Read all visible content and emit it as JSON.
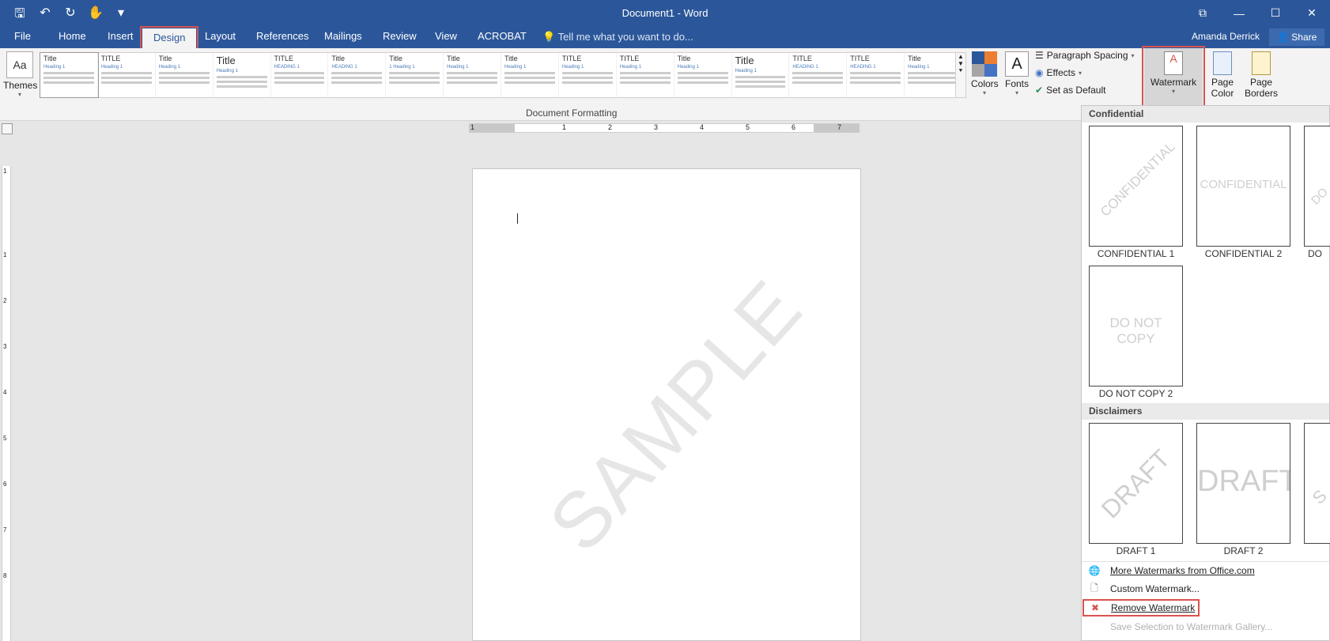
{
  "window": {
    "title": "Document1 - Word"
  },
  "qat": {
    "save": "🖫",
    "undo": "↶",
    "redo": "↻",
    "touch": "✋",
    "more": "▾"
  },
  "window_controls": {
    "restore": "⧉",
    "minimize": "—",
    "maximize": "☐",
    "close": "✕"
  },
  "tabs": {
    "file": "File",
    "home": "Home",
    "insert": "Insert",
    "design": "Design",
    "layout": "Layout",
    "references": "References",
    "mailings": "Mailings",
    "review": "Review",
    "view": "View",
    "acrobat": "ACROBAT"
  },
  "tell_me": "Tell me what you want to do...",
  "user": {
    "name": "Amanda Derrick",
    "share": "Share"
  },
  "ribbon": {
    "themes": "Themes",
    "themes_icon": "Aa",
    "group_label": "Document Formatting",
    "style_items": [
      {
        "title": "Title",
        "heading": "Heading 1"
      },
      {
        "title": "TITLE",
        "heading": "Heading 1"
      },
      {
        "title": "Title",
        "heading": "Heading 1"
      },
      {
        "title": "Title",
        "heading": "Heading 1"
      },
      {
        "title": "TITLE",
        "heading": "HEADING 1"
      },
      {
        "title": "Title",
        "heading": "HEADING 1"
      },
      {
        "title": "Title",
        "heading": "1 Heading 1"
      },
      {
        "title": "Title",
        "heading": "Heading 1"
      },
      {
        "title": "Title",
        "heading": "Heading 1"
      },
      {
        "title": "TITLE",
        "heading": "Heading 1"
      },
      {
        "title": "TITLE",
        "heading": "Heading 1"
      },
      {
        "title": "Title",
        "heading": "Heading 1"
      },
      {
        "title": "Title",
        "heading": "Heading 1"
      },
      {
        "title": "TITLE",
        "heading": "HEADING 1"
      },
      {
        "title": "TITLE",
        "heading": "HEADING 1"
      },
      {
        "title": "Title",
        "heading": "Heading 1"
      }
    ],
    "colors": "Colors",
    "fonts": "Fonts",
    "fonts_icon": "A",
    "paragraph_spacing": "Paragraph Spacing",
    "effects": "Effects",
    "set_as_default": "Set as Default",
    "watermark": "Watermark",
    "page_color_1": "Page",
    "page_color_2": "Color",
    "page_borders_1": "Page",
    "page_borders_2": "Borders"
  },
  "ruler": {
    "h_numbers": [
      "1",
      "1",
      "2",
      "3",
      "4",
      "5",
      "6",
      "7"
    ],
    "v_numbers": [
      "1",
      "1",
      "2",
      "3",
      "4",
      "5",
      "6",
      "7",
      "8"
    ]
  },
  "document": {
    "watermark_text": "SAMPLE"
  },
  "watermark_gallery": {
    "confidential_header": "Confidential",
    "disclaimers_header": "Disclaimers",
    "items": [
      {
        "caption": "CONFIDENTIAL 1",
        "text": "CONFIDENTIAL"
      },
      {
        "caption": "CONFIDENTIAL 2",
        "text": "CONFIDENTIAL"
      },
      {
        "caption": "DO",
        "text": "DO"
      },
      {
        "caption": "DO NOT COPY 2",
        "text": "DO NOT COPY"
      },
      {
        "caption": "DRAFT 1",
        "text": "DRAFT"
      },
      {
        "caption": "DRAFT 2",
        "text": "DRAFT"
      },
      {
        "caption": "",
        "text": "S"
      }
    ],
    "menu": {
      "more": "More Watermarks from Office.com",
      "custom": "Custom Watermark...",
      "remove": "Remove Watermark",
      "save": "Save Selection to Watermark Gallery..."
    }
  },
  "colors": {
    "accent": "#2b579a",
    "highlight": "#d9534f"
  }
}
